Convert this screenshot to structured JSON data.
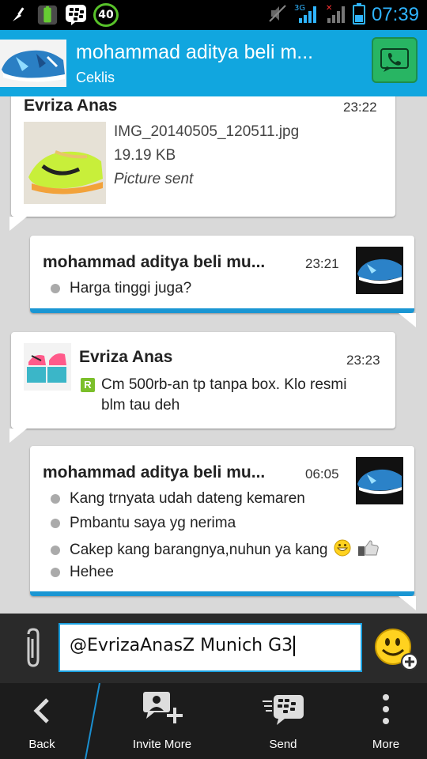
{
  "status_bar": {
    "badge": "40",
    "network": "3G",
    "time": "07:39",
    "accent_color": "#2fb4ff"
  },
  "header": {
    "title": "mohammad aditya beli m...",
    "subtitle": "Ceklis",
    "call_icon": "phone-icon",
    "background": "#11a6df"
  },
  "messages": [
    {
      "sender": "Evriza Anas",
      "time": "23:22",
      "file_name": "IMG_20140505_120511.jpg",
      "file_size": "19.19 KB",
      "status": "Picture sent"
    },
    {
      "sender": "mohammad aditya beli mu...",
      "time": "23:21",
      "lines": [
        "Harga tinggi juga?"
      ]
    },
    {
      "sender": "Evriza Anas",
      "time": "23:23",
      "lines": [
        "Cm 500rb-an tp tanpa box. Klo resmi",
        "blm tau deh"
      ]
    },
    {
      "sender": "mohammad aditya beli mu...",
      "time": "06:05",
      "lines": [
        "Kang trnyata udah dateng kemaren",
        "Pmbantu saya yg nerima",
        "Cakep kang barangnya,nuhun ya kang",
        "Hehee"
      ]
    }
  ],
  "composer": {
    "value": "@EvrizaAnasZ Munich G3",
    "attach_icon": "paperclip-icon",
    "emoji_icon": "smiley-icon"
  },
  "actions": {
    "back": "Back",
    "invite": "Invite More",
    "send": "Send",
    "more": "More"
  }
}
